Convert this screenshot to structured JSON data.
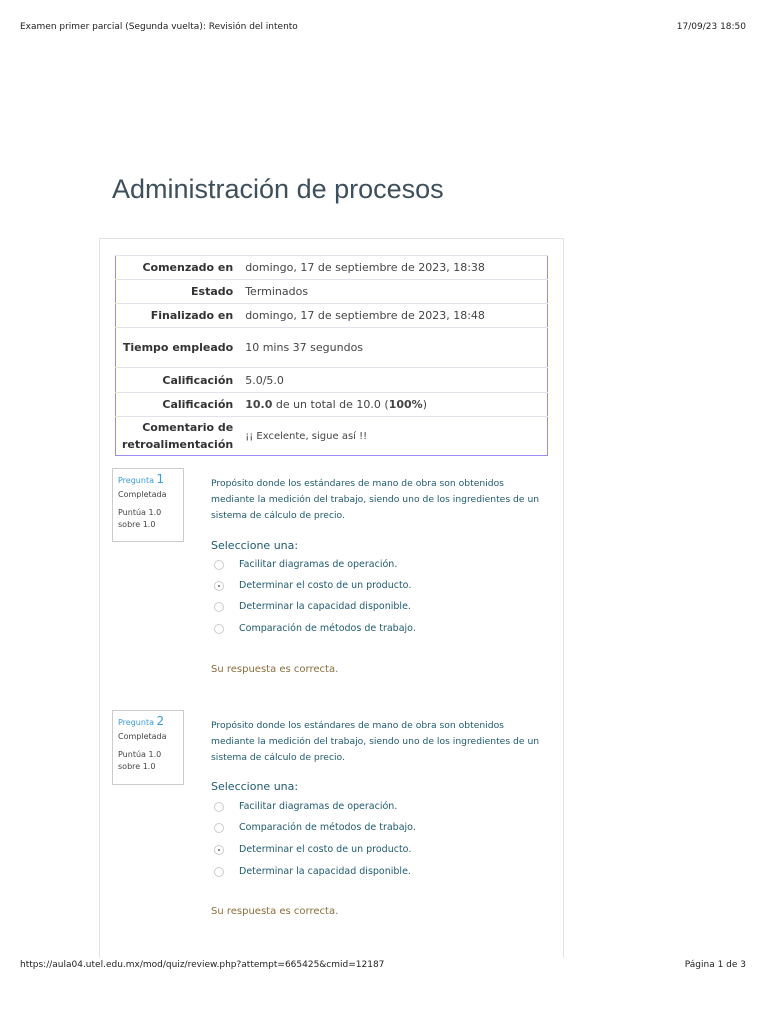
{
  "header": {
    "title": "Examen primer parcial (Segunda vuelta): Revisión del intento",
    "datetime": "17/09/23 18:50"
  },
  "footer": {
    "url": "https://aula04.utel.edu.mx/mod/quiz/review.php?attempt=665425&cmid=12187",
    "page": "Página 1 de 3"
  },
  "page_title": "Administración de procesos",
  "summary": [
    {
      "label": "Comenzado en",
      "value": "domingo, 17 de septiembre de 2023, 18:38"
    },
    {
      "label": "Estado",
      "value": "Terminados"
    },
    {
      "label": "Finalizado en",
      "value": "domingo, 17 de septiembre de 2023, 18:48"
    },
    {
      "label": "Tiempo empleado",
      "value": "10 mins 37 segundos"
    },
    {
      "label": "Calificación",
      "value": "5.0/5.0"
    },
    {
      "label": "Calificación",
      "value_bold1": "10.0",
      "value_mid": " de un total de 10.0 (",
      "value_bold2": "100%",
      "value_end": ")"
    },
    {
      "label": "Comentario de retroalimentación",
      "value": "¡¡ Excelente, sigue así !!"
    }
  ],
  "questions": [
    {
      "label": "Pregunta",
      "number": "1",
      "status": "Completada",
      "score": "Puntúa 1.0 sobre 1.0",
      "text": "Propósito donde los estándares de mano de obra son obtenidos mediante la medición del trabajo, siendo uno de los ingredientes de un sistema de cálculo de precio.",
      "prompt": "Seleccione una:",
      "options": [
        "Facilitar diagramas de operación.",
        "Determinar el costo de un producto.",
        "Determinar la capacidad disponible.",
        "Comparación de métodos de trabajo."
      ],
      "selected": 1,
      "feedback": "Su respuesta es correcta."
    },
    {
      "label": "Pregunta",
      "number": "2",
      "status": "Completada",
      "score": "Puntúa 1.0 sobre 1.0",
      "text": "Propósito donde los estándares de mano de obra son obtenidos mediante la medición del trabajo, siendo uno de los ingredientes de un sistema de cálculo de precio.",
      "prompt": "Seleccione una:",
      "options": [
        "Facilitar diagramas de operación.",
        "Comparación de métodos de trabajo.",
        "Determinar el costo de un producto.",
        "Determinar la capacidad disponible."
      ],
      "selected": 2,
      "feedback": "Su respuesta es correcta."
    }
  ]
}
